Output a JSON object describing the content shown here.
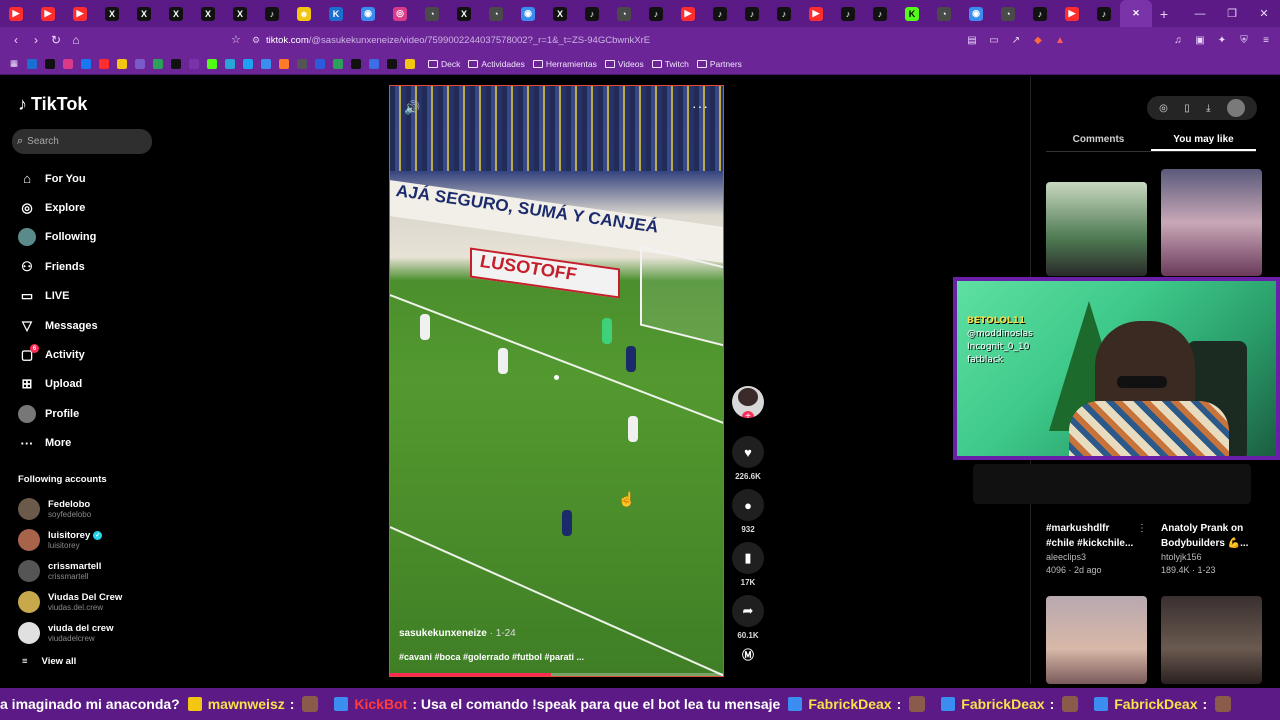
{
  "browser": {
    "url_host": "tiktok.com",
    "url_path": "/@sasukekunxeneize/video/7599002244037578002?_r=1&_t=ZS-94GCbwnkXrE",
    "tabs_icons": [
      "youtube",
      "youtube",
      "youtube",
      "x",
      "x",
      "x",
      "x",
      "x",
      "tiktok",
      "smile",
      "k",
      "chrome",
      "instagram",
      "edge",
      "x",
      "edge",
      "chrome",
      "x",
      "tiktok",
      "edge",
      "tiktok",
      "youtube",
      "tiktok",
      "tiktok",
      "tiktok",
      "youtube",
      "tiktok",
      "tiktok",
      "kick",
      "edge",
      "chrome",
      "edge",
      "tiktok",
      "youtube",
      "tiktok",
      "close"
    ],
    "new_tab_label": "+",
    "bookmarks_folders": [
      "Deck",
      "Actividades",
      "Herramientas",
      "Videos",
      "Twitch",
      "Partners"
    ]
  },
  "tiktok": {
    "logo_text": "TikTok",
    "search_placeholder": "Search",
    "menu": [
      {
        "label": "For You",
        "icon": "home-icon"
      },
      {
        "label": "Explore",
        "icon": "compass-icon"
      },
      {
        "label": "Following",
        "icon": "avatar-icon"
      },
      {
        "label": "Friends",
        "icon": "friends-icon"
      },
      {
        "label": "LIVE",
        "icon": "live-icon"
      },
      {
        "label": "Messages",
        "icon": "messages-icon"
      },
      {
        "label": "Activity",
        "icon": "activity-icon",
        "badge": "6"
      },
      {
        "label": "Upload",
        "icon": "upload-icon"
      },
      {
        "label": "Profile",
        "icon": "profile-icon"
      },
      {
        "label": "More",
        "icon": "more-icon"
      }
    ],
    "following_title": "Following accounts",
    "following": [
      {
        "name": "Fedelobo",
        "handle": "soyfedelobo",
        "color": "#6b5a4a"
      },
      {
        "name": "luisitorey",
        "handle": "luisitorey",
        "verified": true,
        "color": "#a8644a"
      },
      {
        "name": "crissmartell",
        "handle": "crissmartell",
        "color": "#555"
      },
      {
        "name": "Viudas Del Crew",
        "handle": "viudas.del.crew",
        "color": "#c7a84a"
      },
      {
        "name": "viuda del crew",
        "handle": "viudadelcrew",
        "color": "#e0e0e0"
      }
    ],
    "view_all": "View all"
  },
  "video": {
    "banner_text": "AJÁ SEGURO, SUMÁ Y CANJEÁ",
    "sponsor": "LUSOTOFF",
    "author": "sasukekunxeneize",
    "date": "1-24",
    "caption": "#cavani #boca #golerrado #futbol #parati ...",
    "progress_pct": 48
  },
  "actions": {
    "likes": "226.6K",
    "comments": "932",
    "saves": "17K",
    "shares": "60.1K"
  },
  "right_panel": {
    "tab_comments": "Comments",
    "tab_you_may_like": "You may like",
    "cards": [
      {
        "title": "#markushdlfr",
        "subtitle": "#chile #kickchile...",
        "user": "aleeclips3",
        "meta": "4096 · 2d ago"
      },
      {
        "title": "Anatoly Prank on",
        "subtitle": "Bodybuilders 💪...",
        "user": "htolyjk156",
        "meta": "189.4K · 1-23"
      }
    ]
  },
  "stream_overlay": {
    "cam_lines": [
      "BETOLOL11",
      "@moddinoslas",
      "Incognit_0_10",
      "fatblack"
    ]
  },
  "ticker": {
    "segments": [
      {
        "user": "",
        "text": "a imaginado mi anaconda?"
      },
      {
        "user": "mawnweisz",
        "text": ":"
      },
      {
        "user": "KickBot",
        "text": ": Usa el comando !speak para que el bot lea tu mensaje",
        "user_color": "#ff3b3b"
      },
      {
        "user": "FabrickDeax",
        "text": ":"
      },
      {
        "user": "FabrickDeax",
        "text": ":"
      },
      {
        "user": "FabrickDeax",
        "text": ":"
      }
    ],
    "user_color": "#f7e14b"
  }
}
